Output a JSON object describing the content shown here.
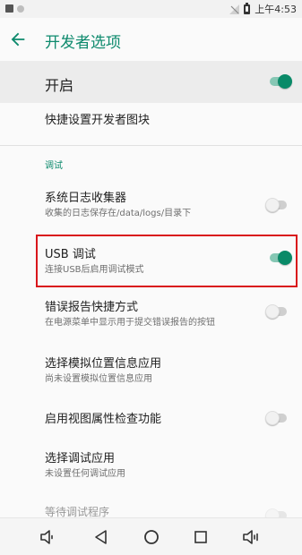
{
  "status_bar": {
    "time": "上午4:53"
  },
  "app_bar": {
    "title": "开发者选项"
  },
  "master": {
    "label": "开启",
    "enabled": true
  },
  "quick_tile": {
    "title": "快捷设置开发者图块"
  },
  "section_debug": "调试",
  "settings": {
    "bug_report_logger": {
      "title": "系统日志收集器",
      "summary": "收集的日志保存在/data/logs/目录下",
      "enabled": false
    },
    "usb_debugging": {
      "title": "USB 调试",
      "summary": "连接USB后启用调试模式",
      "enabled": true
    },
    "bug_report_shortcut": {
      "title": "错误报告快捷方式",
      "summary": "在电源菜单中显示用于提交错误报告的按钮",
      "enabled": false
    },
    "mock_location": {
      "title": "选择模拟位置信息应用",
      "summary": "尚未设置模拟位置信息应用"
    },
    "view_attribute": {
      "title": "启用视图属性检查功能",
      "enabled": false
    },
    "debug_app": {
      "title": "选择调试应用",
      "summary": "未设置任何调试应用"
    },
    "wait_debugger": {
      "title": "等待调试程序"
    }
  },
  "colors": {
    "accent": "#0e8a6d",
    "toggle_on": "#0a8a68",
    "highlight": "#d9161b"
  }
}
